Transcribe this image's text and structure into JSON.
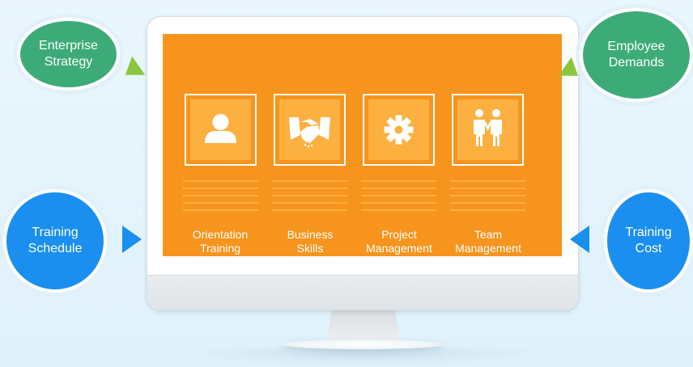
{
  "bubbles": {
    "enterprise_strategy": {
      "line1": "Enterprise",
      "line2": "Strategy"
    },
    "employee_demands": {
      "line1": "Employee",
      "line2": "Demands"
    },
    "training_schedule": {
      "line1": "Training",
      "line2": "Schedule"
    },
    "training_cost": {
      "line1": "Training",
      "line2": "Cost"
    }
  },
  "cards": [
    {
      "icon": "person-icon",
      "line1": "Orientation",
      "line2": "Training"
    },
    {
      "icon": "handshake-icon",
      "line1": "Business",
      "line2": "Skills"
    },
    {
      "icon": "gear-icon",
      "line1": "Project",
      "line2": "Management"
    },
    {
      "icon": "team-icon",
      "line1": "Team",
      "line2": "Management"
    }
  ],
  "colors": {
    "screen": "#f7941d",
    "tile": "#fbb040",
    "green": "#3dab78",
    "blue": "#1a8ff0",
    "arrow_green": "#8cc63f"
  }
}
